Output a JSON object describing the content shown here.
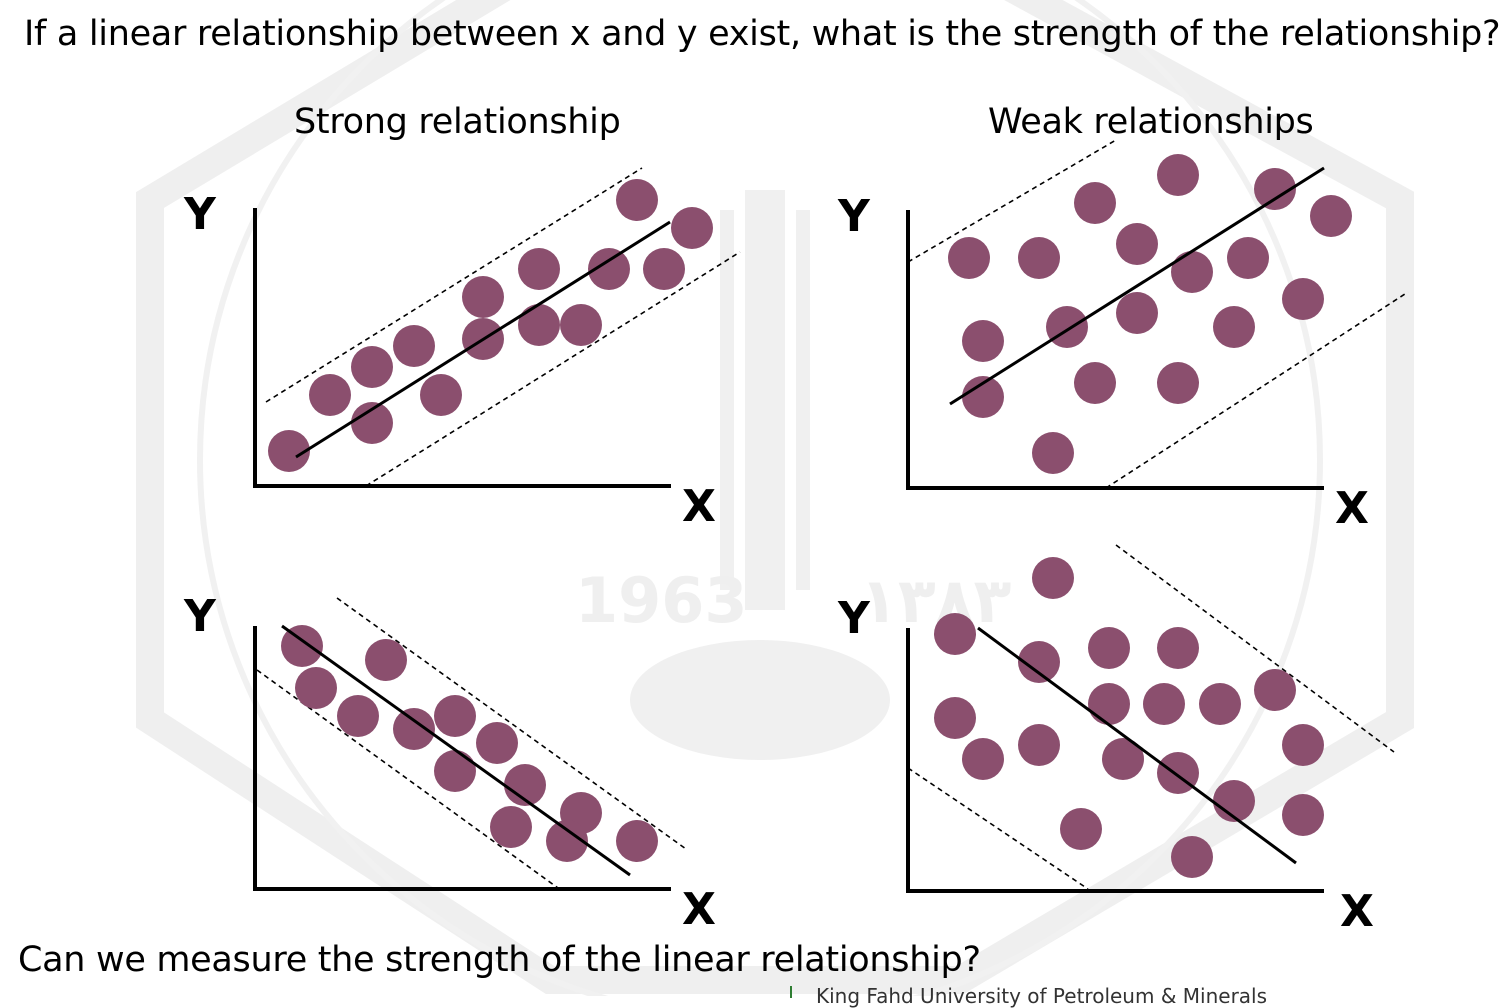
{
  "question": "If a linear relationship between x and y exist, what is the strength of the relationship?",
  "subtitles": {
    "strong": "Strong relationship",
    "weak": "Weak relationships"
  },
  "footer": {
    "question": "Can we measure the strength of the linear relationship?",
    "university": "King Fahd University of Petroleum & Minerals"
  },
  "watermark": {
    "year": "1963",
    "year_arabic": "١٣٨٣"
  },
  "axis_labels": {
    "x": "X",
    "y": "Y"
  },
  "colors": {
    "dot": "#8b4f6e",
    "line": "#000000",
    "watermark": "#eeeeee"
  }
}
